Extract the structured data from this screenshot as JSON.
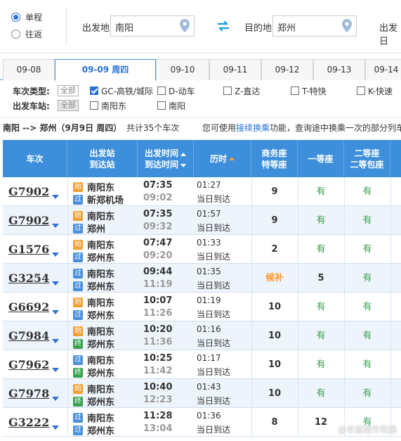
{
  "search": {
    "trip_options": [
      {
        "label": "单程",
        "selected": true
      },
      {
        "label": "往返",
        "selected": false
      }
    ],
    "from_label": "出发地",
    "from_value": "南阳",
    "to_label": "目的地",
    "to_value": "郑州",
    "date_label": "出发日"
  },
  "date_tabs": [
    {
      "label": "09-08",
      "active": false
    },
    {
      "label": "09-09 周四",
      "active": true
    },
    {
      "label": "09-10",
      "active": false
    },
    {
      "label": "09-11",
      "active": false
    },
    {
      "label": "09-12",
      "active": false
    },
    {
      "label": "09-13",
      "active": false
    },
    {
      "label": "09-14",
      "active": false
    }
  ],
  "filters": {
    "type_label": "车次类型:",
    "station_label": "出发车站:",
    "all_label": "全部",
    "train_types": [
      {
        "label": "GC-高铁/城际",
        "checked": true
      },
      {
        "label": "D-动车",
        "checked": false
      },
      {
        "label": "Z-直达",
        "checked": false
      },
      {
        "label": "T-特快",
        "checked": false
      },
      {
        "label": "K-快速",
        "checked": false
      }
    ],
    "stations": [
      {
        "label": "南阳东",
        "checked": false
      },
      {
        "label": "南阳",
        "checked": false
      }
    ]
  },
  "summary": {
    "route": "南阳 --> 郑州（9月9日 周四）",
    "count": "共计35个车次",
    "tip_before": "您可使用",
    "tip_link": "接续换乘",
    "tip_after": "功能，查询途中换乘一次的部分列车"
  },
  "table": {
    "headers": {
      "train": "车次",
      "station_top": "出发站",
      "station_bottom": "到达站",
      "time_top": "出发时间",
      "time_bottom": "到达时间",
      "duration": "历时",
      "biz_top": "商务座",
      "biz_bottom": "特等座",
      "first": "一等座",
      "second_top": "二等座",
      "second_bottom": "二等包座"
    },
    "rows": [
      {
        "train": "G7902",
        "from_badge": "始",
        "from": "南阳东",
        "to_badge": "过",
        "to": "新郑机场",
        "dep": "07:35",
        "arr": "09:02",
        "dur": "01:27",
        "arrive_day": "当日到达",
        "biz": "9",
        "first": "有",
        "second": "有"
      },
      {
        "train": "G7902",
        "from_badge": "始",
        "from": "南阳东",
        "to_badge": "过",
        "to": "郑州",
        "dep": "07:35",
        "arr": "09:32",
        "dur": "01:57",
        "arrive_day": "当日到达",
        "biz": "9",
        "first": "有",
        "second": "有"
      },
      {
        "train": "G1576",
        "from_badge": "始",
        "from": "南阳东",
        "to_badge": "过",
        "to": "郑州东",
        "dep": "07:47",
        "arr": "09:20",
        "dur": "01:33",
        "arrive_day": "当日到达",
        "biz": "2",
        "first": "有",
        "second": "有"
      },
      {
        "train": "G3254",
        "from_badge": "过",
        "from": "南阳东",
        "to_badge": "过",
        "to": "郑州东",
        "dep": "09:44",
        "arr": "11:19",
        "dur": "01:35",
        "arrive_day": "当日到达",
        "biz": "候补",
        "first": "5",
        "second": "有"
      },
      {
        "train": "G6692",
        "from_badge": "始",
        "from": "南阳东",
        "to_badge": "过",
        "to": "郑州东",
        "dep": "10:07",
        "arr": "11:26",
        "dur": "01:19",
        "arrive_day": "当日到达",
        "biz": "10",
        "first": "有",
        "second": "有"
      },
      {
        "train": "G7984",
        "from_badge": "始",
        "from": "南阳东",
        "to_badge": "终",
        "to": "郑州东",
        "dep": "10:20",
        "arr": "11:36",
        "dur": "01:16",
        "arrive_day": "当日到达",
        "biz": "10",
        "first": "有",
        "second": "有"
      },
      {
        "train": "G7962",
        "from_badge": "过",
        "from": "南阳东",
        "to_badge": "终",
        "to": "郑州东",
        "dep": "10:25",
        "arr": "11:42",
        "dur": "01:17",
        "arrive_day": "当日到达",
        "biz": "10",
        "first": "有",
        "second": "有"
      },
      {
        "train": "G7978",
        "from_badge": "始",
        "from": "南阳东",
        "to_badge": "终",
        "to": "郑州东",
        "dep": "10:40",
        "arr": "12:23",
        "dur": "01:43",
        "arrive_day": "当日到达",
        "biz": "10",
        "first": "有",
        "second": "有"
      },
      {
        "train": "G3222",
        "from_badge": "过",
        "from": "南阳东",
        "to_badge": "过",
        "to": "郑州东",
        "dep": "11:28",
        "arr": "13:04",
        "dur": "01:36",
        "arrive_day": "当日到达",
        "biz": "8",
        "first": "12",
        "second": "有"
      }
    ]
  },
  "watermark": "@幸福城市铁路",
  "colors": {
    "header_blue": "#3d8fdb",
    "link_blue": "#2b72d6",
    "available_green": "#3aa050",
    "waitlist_orange": "#ff9a2e",
    "badge_start": "#f0a030",
    "badge_pass": "#4a8fd8",
    "badge_end": "#3aa050"
  }
}
